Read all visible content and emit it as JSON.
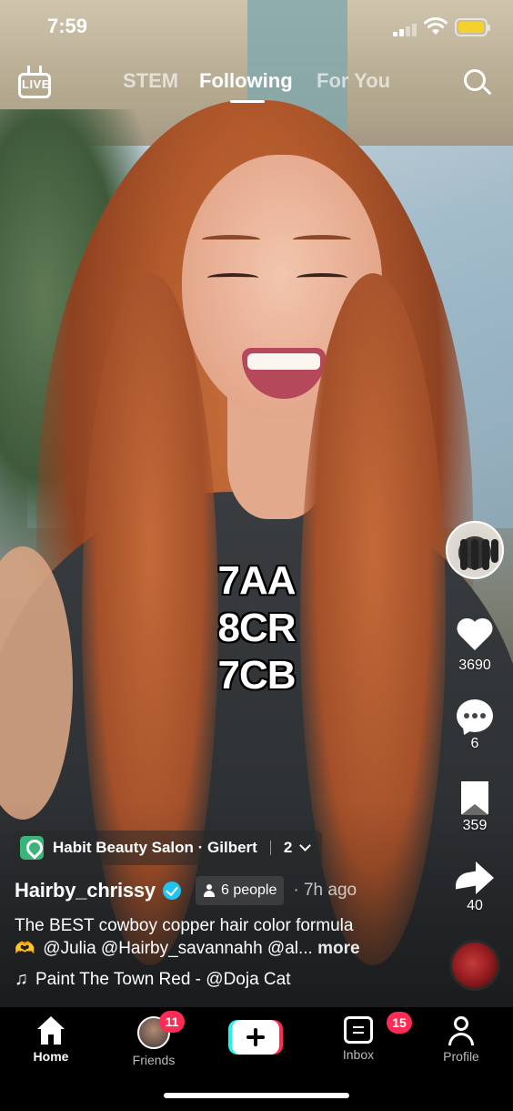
{
  "status_bar": {
    "time": "7:59"
  },
  "top_nav": {
    "live_label": "LIVE",
    "tabs": [
      {
        "label": "STEM",
        "active": false
      },
      {
        "label": "Following",
        "active": true
      },
      {
        "label": "For You",
        "active": false
      }
    ]
  },
  "video": {
    "overlay_text": [
      "7AA",
      "8CR",
      "7CB"
    ]
  },
  "actions": {
    "likes": "3690",
    "comments": "6",
    "saves": "359",
    "shares": "40"
  },
  "post": {
    "location": "Habit Beauty Salon · Gilbert",
    "location_count": "2",
    "username": "Hairby_chrissy",
    "tagged_people": "6 people",
    "time_ago": "· 7h ago",
    "caption_line1": "The BEST cowboy copper hair color formula",
    "caption_emoji": "🫶",
    "caption_line2": "@Julia @Hairby_savannahh @al...",
    "more_label": "more",
    "sound": "Paint The Town Red - @Doja Cat"
  },
  "bottom_tabs": {
    "home": "Home",
    "friends": "Friends",
    "friends_badge": "11",
    "inbox": "Inbox",
    "inbox_badge": "15",
    "profile": "Profile"
  },
  "colors": {
    "badge": "#fe2c55",
    "verified": "#20c4f0",
    "location_pin": "#3bb47a",
    "create_cyan": "#25f4ee",
    "create_red": "#fe2c55",
    "battery": "#f5d130"
  }
}
